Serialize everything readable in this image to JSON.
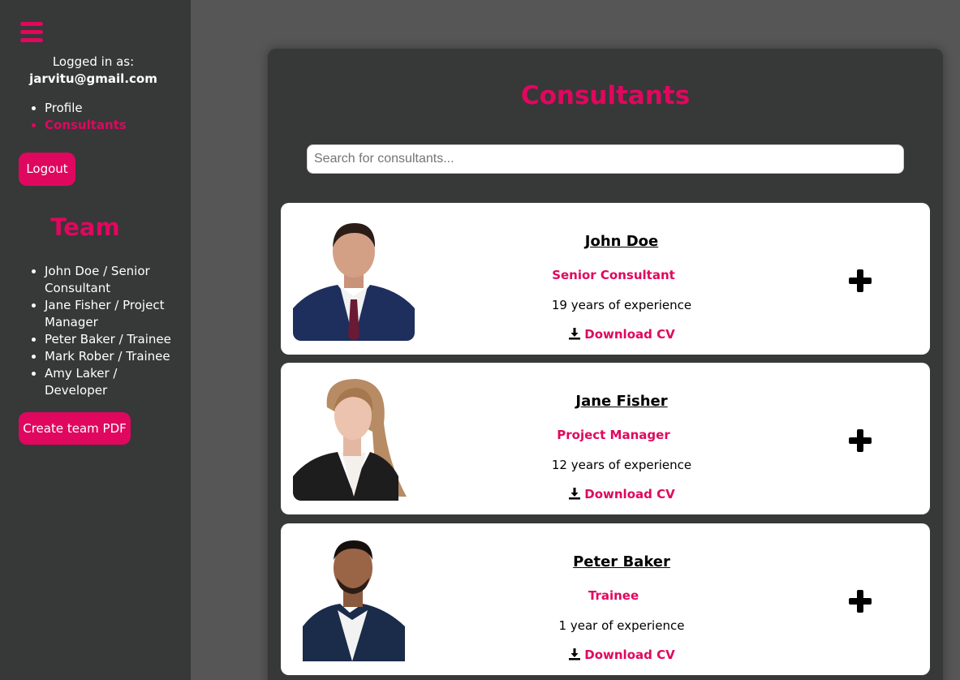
{
  "sidebar": {
    "menu_icon": "hamburger-icon",
    "logged_in_label": "Logged in as:",
    "email": "jarvitu@gmail.com",
    "nav": [
      {
        "label": "Profile"
      },
      {
        "label": "Consultants"
      }
    ],
    "logout_label": "Logout",
    "team_title": "Team",
    "team": [
      {
        "label": "John Doe / Senior Consultant"
      },
      {
        "label": "Jane Fisher / Project Manager"
      },
      {
        "label": "Peter Baker / Trainee"
      },
      {
        "label": "Mark Rober / Trainee"
      },
      {
        "label": "Amy Laker / Developer"
      }
    ],
    "pdf_label": "Create team PDF"
  },
  "main": {
    "title": "Consultants",
    "search_placeholder": "Search for consultants..."
  },
  "consultants": [
    {
      "name": "John Doe",
      "role": "Senior Consultant",
      "experience": "19 years of experience",
      "cv_label": "Download CV"
    },
    {
      "name": "Jane Fisher",
      "role": "Project Manager",
      "experience": "12 years of experience",
      "cv_label": "Download CV"
    },
    {
      "name": "Peter Baker",
      "role": "Trainee",
      "experience": "1 year of experience",
      "cv_label": "Download CV"
    }
  ],
  "colors": {
    "accent": "#e0075f",
    "sidebar": "#373838",
    "background": "#565656"
  }
}
